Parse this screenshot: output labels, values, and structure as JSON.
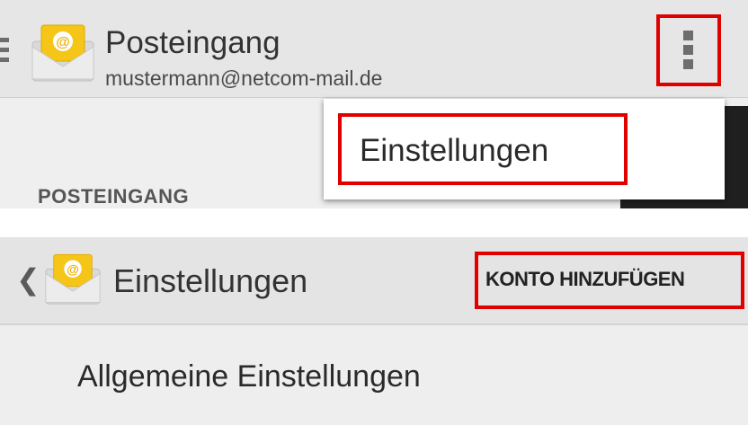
{
  "inbox_screen": {
    "title": "Posteingang",
    "account_email": "mustermann@netcom-mail.de",
    "section_header": "POSTEINGANG",
    "overflow_menu": {
      "icon": "more-vertical-icon",
      "items": [
        {
          "label": "Einstellungen"
        }
      ]
    }
  },
  "settings_screen": {
    "back_icon": "chevron-left-icon",
    "title": "Einstellungen",
    "action_button_label": "KONTO HINZUFÜGEN",
    "list_items": [
      {
        "label": "Allgemeine Einstellungen"
      }
    ]
  },
  "colors": {
    "highlight": "#e00000",
    "icon_yellow": "#f5c518",
    "action_bar": "#e6e6e6"
  }
}
